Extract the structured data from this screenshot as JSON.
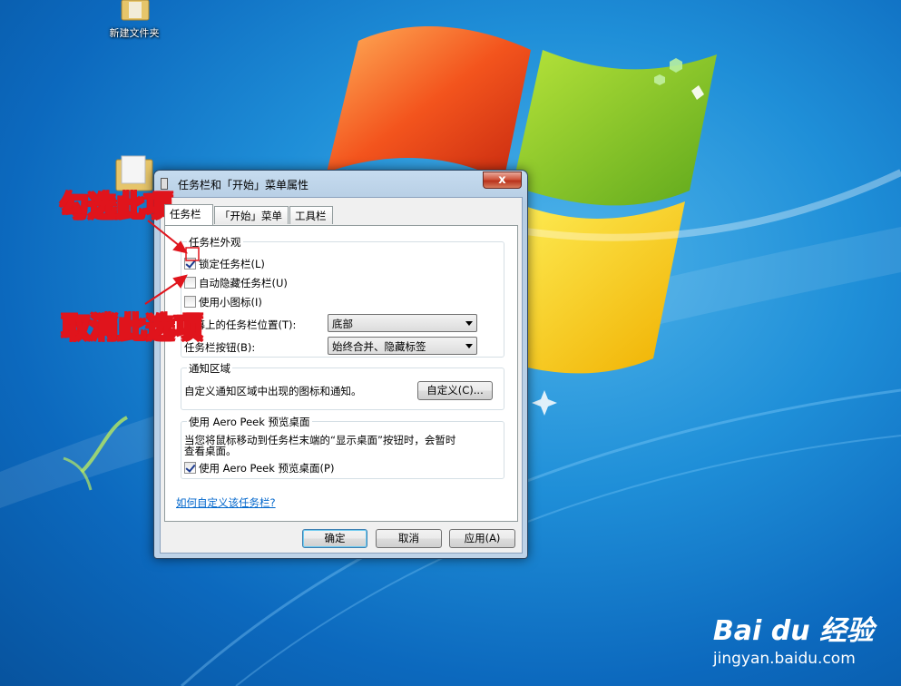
{
  "desktop": {
    "icons": [
      {
        "label": "新建文件夹"
      }
    ]
  },
  "dialog": {
    "title": "任务栏和「开始」菜单属性",
    "close_glyph": "x",
    "tabs": [
      {
        "label": "任务栏"
      },
      {
        "label": "「开始」菜单"
      },
      {
        "label": "工具栏"
      }
    ],
    "appearance": {
      "title": "任务栏外观",
      "options": [
        {
          "label": "锁定任务栏(L)",
          "checked": true
        },
        {
          "label": "自动隐藏任务栏(U)",
          "checked": false
        },
        {
          "label": "使用小图标(I)",
          "checked": false
        }
      ],
      "position_label": "屏幕上的任务栏位置(T):",
      "position_value": "底部",
      "buttons_label": "任务栏按钮(B):",
      "buttons_value": "始终合并、隐藏标签"
    },
    "notification": {
      "title": "通知区域",
      "description": "自定义通知区域中出现的图标和通知。",
      "customize_button": "自定义(C)..."
    },
    "aero_peek": {
      "title": "使用 Aero Peek 预览桌面",
      "description_line1": "当您将鼠标移动到任务栏末端的“显示桌面”按钮时，会暂时",
      "description_line2": "查看桌面。",
      "option_label": "使用 Aero Peek 预览桌面(P)",
      "option_checked": true
    },
    "help_link": "如何自定义该任务栏?",
    "buttons": {
      "ok": "确定",
      "cancel": "取消",
      "apply": "应用(A)"
    }
  },
  "annotations": {
    "check_this": "勾选此项",
    "uncheck_this": "取消此选项",
    "color": "#e0141c"
  },
  "watermark": {
    "brand": "Bai du 经验",
    "url": "jingyan.baidu.com"
  }
}
